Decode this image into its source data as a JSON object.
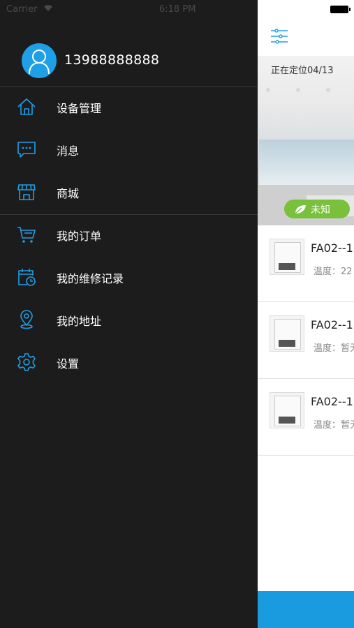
{
  "status_bar": {
    "carrier": "Carrier",
    "time": "6:18 PM"
  },
  "profile": {
    "phone": "13988888888"
  },
  "menu": [
    {
      "label": "设备管理",
      "icon": "home-icon"
    },
    {
      "label": "消息",
      "icon": "message-icon"
    },
    {
      "label": "商城",
      "icon": "store-icon"
    },
    {
      "label": "我的订单",
      "icon": "cart-icon"
    },
    {
      "label": "我的维修记录",
      "icon": "repair-record-icon"
    },
    {
      "label": "我的地址",
      "icon": "location-pin-icon"
    },
    {
      "label": "设置",
      "icon": "gear-icon"
    }
  ],
  "main": {
    "location_text": "正在定位04/13",
    "air_quality": "未知",
    "devices": [
      {
        "name": "FA02--1",
        "temp": "温度：22"
      },
      {
        "name": "FA02--1",
        "temp": "温度：暂无"
      },
      {
        "name": "FA02--1",
        "temp": "温度：暂无"
      }
    ]
  },
  "colors": {
    "accent": "#1f9fe5",
    "drawer_bg": "#1c1c1c",
    "badge_green": "#79c13b",
    "bottom_bar": "#1a9be0"
  }
}
